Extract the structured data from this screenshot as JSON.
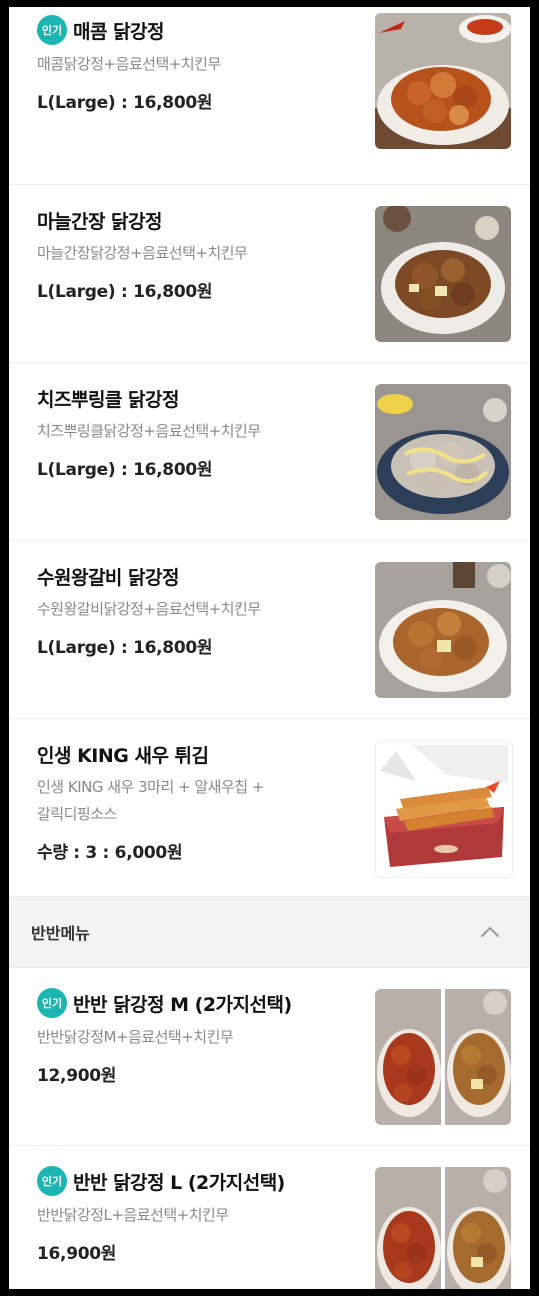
{
  "items": [
    {
      "badge": "인기",
      "title": "매콤 닭강정",
      "desc": "매콤닭강정+음료선택+치킨무",
      "price": "L(Large) : 16,800원",
      "photo": "spicy-chicken"
    },
    {
      "title": "마늘간장 닭강정",
      "desc": "마늘간장닭강정+음료선택+치킨무",
      "price": "L(Large) : 16,800원",
      "photo": "garlic-soy-chicken"
    },
    {
      "title": "치즈뿌링클 닭강정",
      "desc": "치즈뿌링클닭강정+음료선택+치킨무",
      "price": "L(Large) : 16,800원",
      "photo": "cheese-chicken"
    },
    {
      "title": "수원왕갈비 닭강정",
      "desc": "수원왕갈비닭강정+음료선택+치킨무",
      "price": "L(Large) : 16,800원",
      "photo": "galbi-chicken"
    },
    {
      "title": "인생 KING 새우 튀김",
      "desc1": "인생 KING 새우 3마리 + 알새우칩 +",
      "desc2": "갈릭디핑소스",
      "price": "수량 : 3 : 6,000원",
      "photo": "fried-shrimp-box"
    }
  ],
  "section": {
    "title": "반반메뉴",
    "icon": "chevron-up-icon"
  },
  "half_items": [
    {
      "badge": "인기",
      "title": "반반 닭강정 M (2가지선택)",
      "desc": "반반닭강정M+음료선택+치킨무",
      "price": "12,900원",
      "photo": "half-half-chicken"
    },
    {
      "badge": "인기",
      "title": "반반 닭강정 L (2가지선택)",
      "desc": "반반닭강정L+음료선택+치킨무",
      "price": "16,900원",
      "photo": "half-half-chicken"
    }
  ],
  "colors": {
    "badge": "#1bb5b2",
    "section_bg": "#f3f3f3",
    "desc": "#8a8a8a"
  }
}
